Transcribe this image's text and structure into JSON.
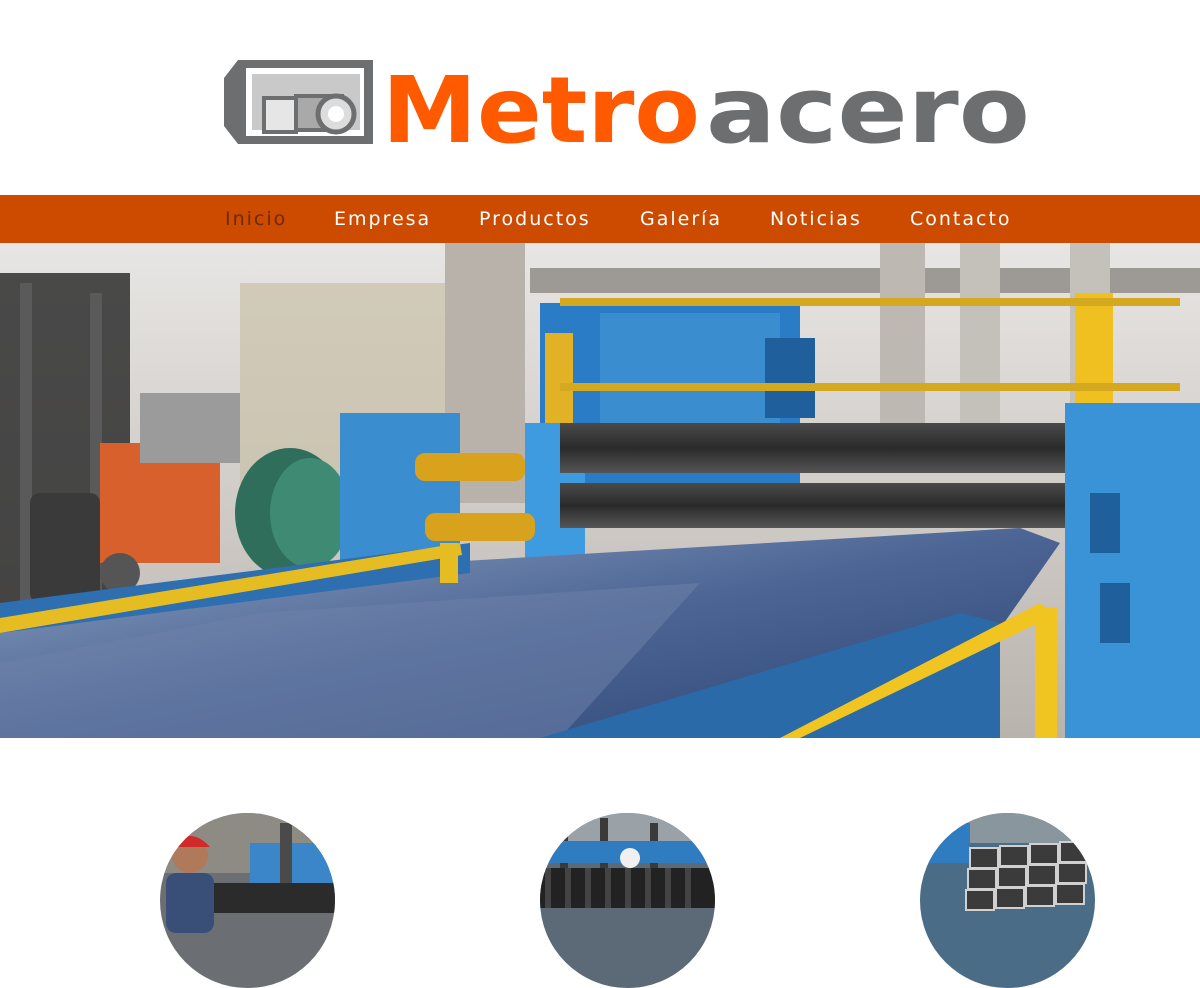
{
  "brand": {
    "name_part1": "Metro",
    "name_part2": "acero",
    "primary_color": "#ff5a00",
    "secondary_color": "#6d6e70"
  },
  "nav": {
    "background": "#cc4b00",
    "active_color": "#6e2a0a",
    "items": [
      {
        "label": "Inicio",
        "active": true
      },
      {
        "label": "Empresa",
        "active": false
      },
      {
        "label": "Productos",
        "active": false
      },
      {
        "label": "Galería",
        "active": false
      },
      {
        "label": "Noticias",
        "active": false
      },
      {
        "label": "Contacto",
        "active": false
      }
    ]
  },
  "hero": {
    "image": "steel-slitting-line-photo"
  },
  "features": [
    {
      "image": "worker-with-hardhat-photo"
    },
    {
      "image": "steel-coil-rolls-photo"
    },
    {
      "image": "rectangular-steel-tubes-photo"
    }
  ]
}
